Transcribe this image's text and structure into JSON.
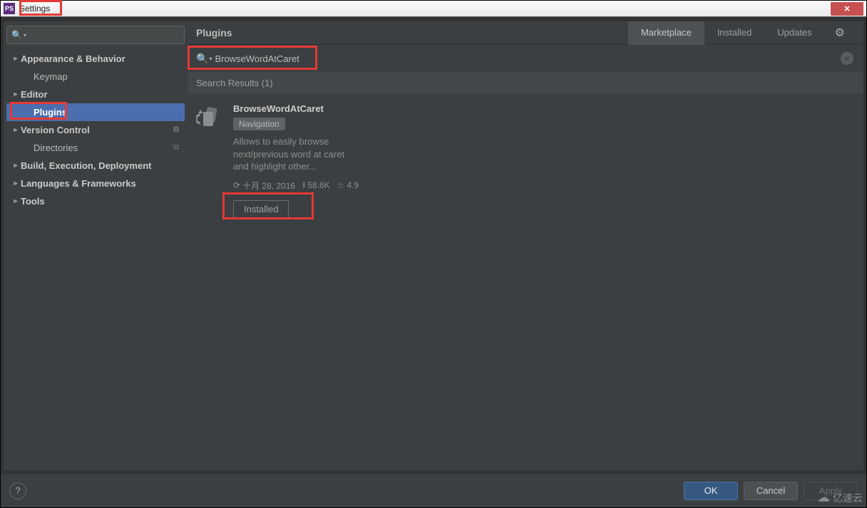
{
  "window": {
    "title": "Settings"
  },
  "sidebar": {
    "items": [
      {
        "label": "Appearance & Behavior",
        "bold": true,
        "arrow": true
      },
      {
        "label": "Keymap",
        "bold": false,
        "child": true
      },
      {
        "label": "Editor",
        "bold": true,
        "arrow": true
      },
      {
        "label": "Plugins",
        "bold": true,
        "child": true,
        "selected": true
      },
      {
        "label": "Version Control",
        "bold": true,
        "arrow": true,
        "copy": true
      },
      {
        "label": "Directories",
        "bold": false,
        "child": true,
        "copy": true
      },
      {
        "label": "Build, Execution, Deployment",
        "bold": true,
        "arrow": true
      },
      {
        "label": "Languages & Frameworks",
        "bold": true,
        "arrow": true
      },
      {
        "label": "Tools",
        "bold": true,
        "arrow": true
      }
    ]
  },
  "main": {
    "title": "Plugins",
    "tabs": {
      "marketplace": "Marketplace",
      "installed": "Installed",
      "updates": "Updates"
    },
    "search_query": "BrowseWordAtCaret",
    "results_label": "Search Results (1)"
  },
  "plugin": {
    "name": "BrowseWordAtCaret",
    "tag": "Navigation",
    "description": "Allows to easily browse next/previous word at caret and highlight other...",
    "date": "十月 28, 2016",
    "downloads": "58.6K",
    "rating": "4.9",
    "install_label": "Installed"
  },
  "footer": {
    "ok": "OK",
    "cancel": "Cancel",
    "apply": "Apply"
  },
  "watermark": "亿速云"
}
